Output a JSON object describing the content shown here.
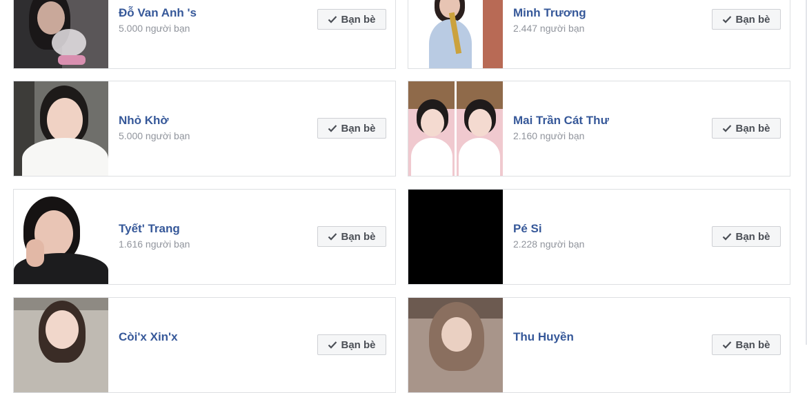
{
  "friends": [
    {
      "name": "Đỗ Van Anh 's",
      "friend_count": "5.000 người bạn",
      "button_label": "Bạn bè"
    },
    {
      "name": "Minh Trương",
      "friend_count": "2.447 người bạn",
      "button_label": "Bạn bè"
    },
    {
      "name": "Nhỏ Khờ",
      "friend_count": "5.000 người bạn",
      "button_label": "Bạn bè"
    },
    {
      "name": "Mai Trần Cát Thư",
      "friend_count": "2.160 người bạn",
      "button_label": "Bạn bè"
    },
    {
      "name": "Tyết' Trang",
      "friend_count": "1.616 người bạn",
      "button_label": "Bạn bè"
    },
    {
      "name": "Pé Si",
      "friend_count": "2.228 người bạn",
      "button_label": "Bạn bè"
    },
    {
      "name": "Còi'x Xin'x",
      "friend_count": "",
      "button_label": "Bạn bè"
    },
    {
      "name": "Thu Huyền",
      "friend_count": "",
      "button_label": "Bạn bè"
    }
  ],
  "icons": {
    "button_icon": "checkmark-icon"
  },
  "colors": {
    "name_link": "#365899",
    "secondary_text": "#90949c",
    "card_border": "#dddfe2",
    "button_bg": "#f5f6f7"
  }
}
